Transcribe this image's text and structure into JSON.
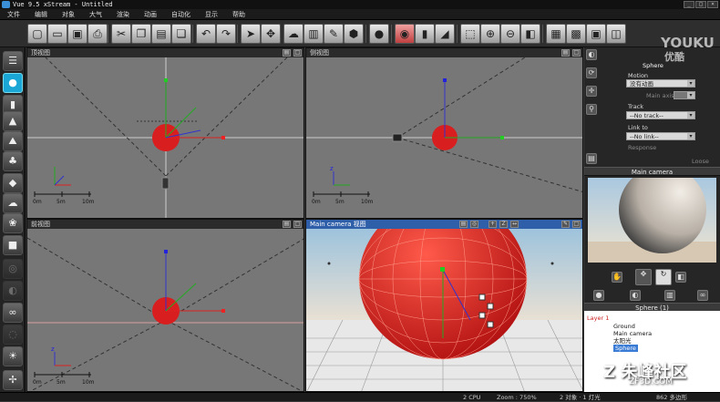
{
  "window": {
    "title": "Vue 9.5 xStream - Untitled",
    "controls": [
      "_",
      "□",
      "×"
    ]
  },
  "menu": [
    "文件",
    "编辑",
    "对象",
    "大气",
    "渲染",
    "动画",
    "自动化",
    "显示",
    "帮助"
  ],
  "toolbar": {
    "icons": [
      "new-icon",
      "open-icon",
      "save-icon",
      "print-icon",
      "cut-icon",
      "copy-icon",
      "paste-icon",
      "duplicate-icon",
      "undo-icon",
      "redo-icon",
      "select-icon",
      "move-icon",
      "atmosphere-icon",
      "material-icon",
      "edit-icon",
      "object-icon",
      "color-icon",
      "render-icon",
      "graph-icon",
      "camera-icon",
      "zoom-icon",
      "zoom-in-icon",
      "zoom-out-icon",
      "fit-icon",
      "film-icon",
      "layout-icon",
      "toggle-icon"
    ]
  },
  "left_tools": {
    "icons": [
      "sky-icon",
      "sphere-icon",
      "cylinder-icon",
      "mountain-icon",
      "terrain-icon",
      "tree-icon",
      "rock-icon",
      "cloud-icon",
      "plant-icon",
      "cube-icon",
      "torus-icon",
      "boolean-icon",
      "metaball-icon",
      "light-icon",
      "fan-icon"
    ]
  },
  "viewports": {
    "top": {
      "title": "顶视图"
    },
    "side": {
      "title": "侧视图"
    },
    "front": {
      "title": "前视图"
    },
    "camera": {
      "title": "Main camera 视图"
    }
  },
  "scale_labels": [
    "0m",
    "5m",
    "10m"
  ],
  "axis_label": "z",
  "right_panel": {
    "object_name": "Sphere",
    "motion_label": "Motion",
    "motion_value": "没有动画",
    "main_axis_label": "Main axis",
    "track_label": "Track",
    "track_value": "--No track--",
    "link_label": "Link to",
    "link_value": "--No link--",
    "response_label": "Response",
    "loose_label": "Loose",
    "preview_title": "Main camera",
    "layers_title": "Sphere (1)",
    "tree": {
      "layer": "Layer 1",
      "items": [
        "Ground",
        "Main camera",
        "太阳光",
        "Sphere"
      ]
    }
  },
  "status": {
    "cpu": "2 CPU",
    "zoom": "Zoom : 750%",
    "objects": "2 对象 · 1 灯光",
    "polygons": "862 多边形"
  },
  "watermarks": {
    "youku": "YOUKU",
    "youku_cn": "优酷",
    "site": "朱峰社区",
    "site_url": "ZF3D.COM"
  },
  "colors": {
    "sphere": "#d81e1e",
    "accent": "#1aa7d6",
    "viewport_bg": "#777777"
  }
}
